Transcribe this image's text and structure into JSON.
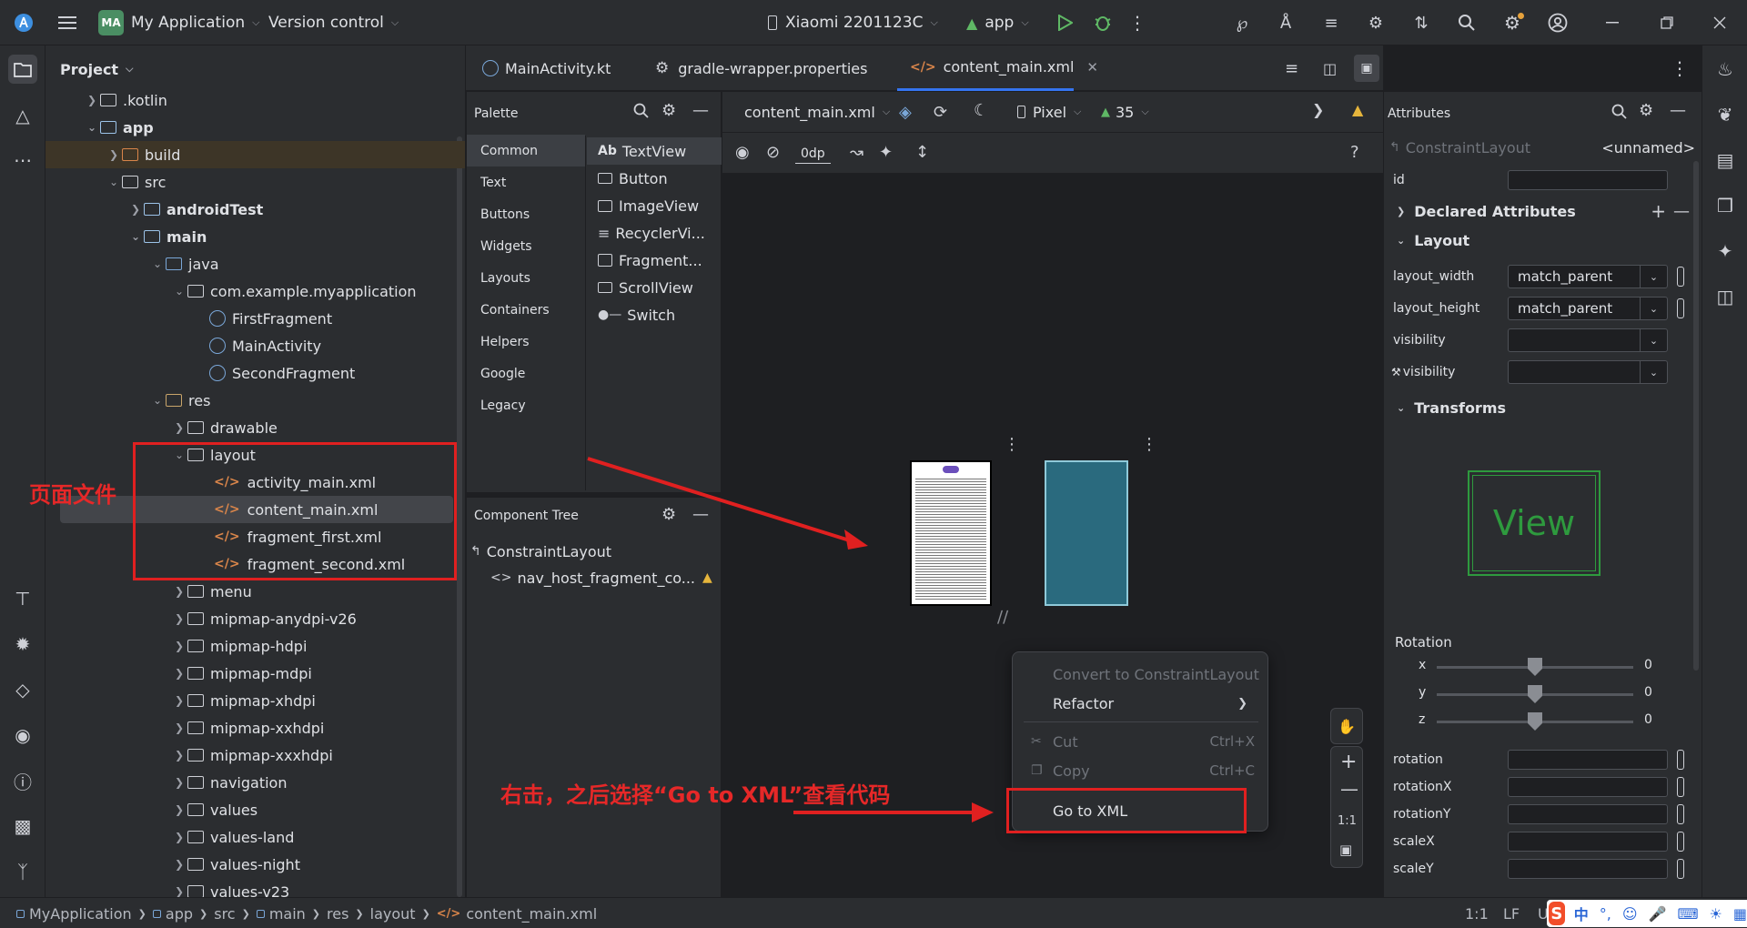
{
  "titlebar": {
    "app_badge": "MA",
    "project_name": "My Application",
    "vcs": "Version control",
    "device": "Xiaomi 2201123C",
    "run_config": "app"
  },
  "project_panel": {
    "title": "Project",
    "items": [
      {
        "label": ".kotlin"
      },
      {
        "label": "app"
      },
      {
        "label": "build"
      },
      {
        "label": "src"
      },
      {
        "label": "androidTest"
      },
      {
        "label": "main"
      },
      {
        "label": "java"
      },
      {
        "label": "com.example.myapplication"
      },
      {
        "label": "FirstFragment"
      },
      {
        "label": "MainActivity"
      },
      {
        "label": "SecondFragment"
      },
      {
        "label": "res"
      },
      {
        "label": "drawable"
      },
      {
        "label": "layout"
      },
      {
        "label": "activity_main.xml"
      },
      {
        "label": "content_main.xml"
      },
      {
        "label": "fragment_first.xml"
      },
      {
        "label": "fragment_second.xml"
      },
      {
        "label": "menu"
      },
      {
        "label": "mipmap-anydpi-v26"
      },
      {
        "label": "mipmap-hdpi"
      },
      {
        "label": "mipmap-mdpi"
      },
      {
        "label": "mipmap-xhdpi"
      },
      {
        "label": "mipmap-xxhdpi"
      },
      {
        "label": "mipmap-xxxhdpi"
      },
      {
        "label": "navigation"
      },
      {
        "label": "values"
      },
      {
        "label": "values-land"
      },
      {
        "label": "values-night"
      },
      {
        "label": "values-v23"
      }
    ]
  },
  "tabs": [
    {
      "label": "MainActivity.kt"
    },
    {
      "label": "gradle-wrapper.properties"
    },
    {
      "label": "content_main.xml"
    }
  ],
  "palette": {
    "title": "Palette",
    "categories": [
      "Common",
      "Text",
      "Buttons",
      "Widgets",
      "Layouts",
      "Containers",
      "Helpers",
      "Google",
      "Legacy"
    ],
    "items": [
      "TextView",
      "Button",
      "ImageView",
      "RecyclerVi...",
      "Fragment...",
      "ScrollView",
      "Switch"
    ],
    "textview_prefix": "Ab"
  },
  "component_tree": {
    "title": "Component Tree",
    "root": "ConstraintLayout",
    "child": "nav_host_fragment_co..."
  },
  "design_toolbar": {
    "file": "content_main.xml",
    "device": "Pixel",
    "api": "35",
    "margin": "0dp"
  },
  "context_menu": {
    "items": [
      {
        "label": "Convert to ConstraintLayout",
        "shortcut": ""
      },
      {
        "label": "Refactor",
        "shortcut": ""
      },
      {
        "label": "Cut",
        "shortcut": "Ctrl+X"
      },
      {
        "label": "Copy",
        "shortcut": "Ctrl+C"
      },
      {
        "label": "Go to XML",
        "shortcut": ""
      }
    ]
  },
  "zoom": {
    "ratio": "1:1"
  },
  "attributes": {
    "title": "Attributes",
    "component": "ConstraintLayout",
    "name": "<unnamed>",
    "id_label": "id",
    "declared": "Declared Attributes",
    "layout_section": "Layout",
    "layout_width_label": "layout_width",
    "layout_width_value": "match_parent",
    "layout_height_label": "layout_height",
    "layout_height_value": "match_parent",
    "visibility_label": "visibility",
    "tools_visibility_label": "visibility",
    "transforms": "Transforms",
    "view_text": "View",
    "rotation_title": "Rotation",
    "axes": [
      {
        "axis": "x",
        "value": "0",
        "level": 0.5
      },
      {
        "axis": "y",
        "value": "0",
        "level": 0.5
      },
      {
        "axis": "z",
        "value": "0",
        "level": 0.5
      }
    ],
    "fields": [
      "rotation",
      "rotationX",
      "rotationY",
      "scaleX",
      "scaleY"
    ]
  },
  "annotations": {
    "page_file_label": "页面文件",
    "right_click_hint": "右击，之后选择“Go to XML”查看代码"
  },
  "statusbar": {
    "breadcrumb": [
      "MyApplication",
      "app",
      "src",
      "main",
      "res",
      "layout",
      "content_main.xml"
    ],
    "position": "1:1",
    "line_sep": "LF",
    "encoding": "U",
    "ime": "中"
  },
  "colors": {
    "background": "#1e1f22",
    "panel": "#2b2d30",
    "accent_red": "#e02020",
    "folder_blue": "#9cc3e9",
    "run_green": "#5fb865",
    "xml_orange": "#d9854a",
    "blueprint": "#2a6a7e"
  }
}
